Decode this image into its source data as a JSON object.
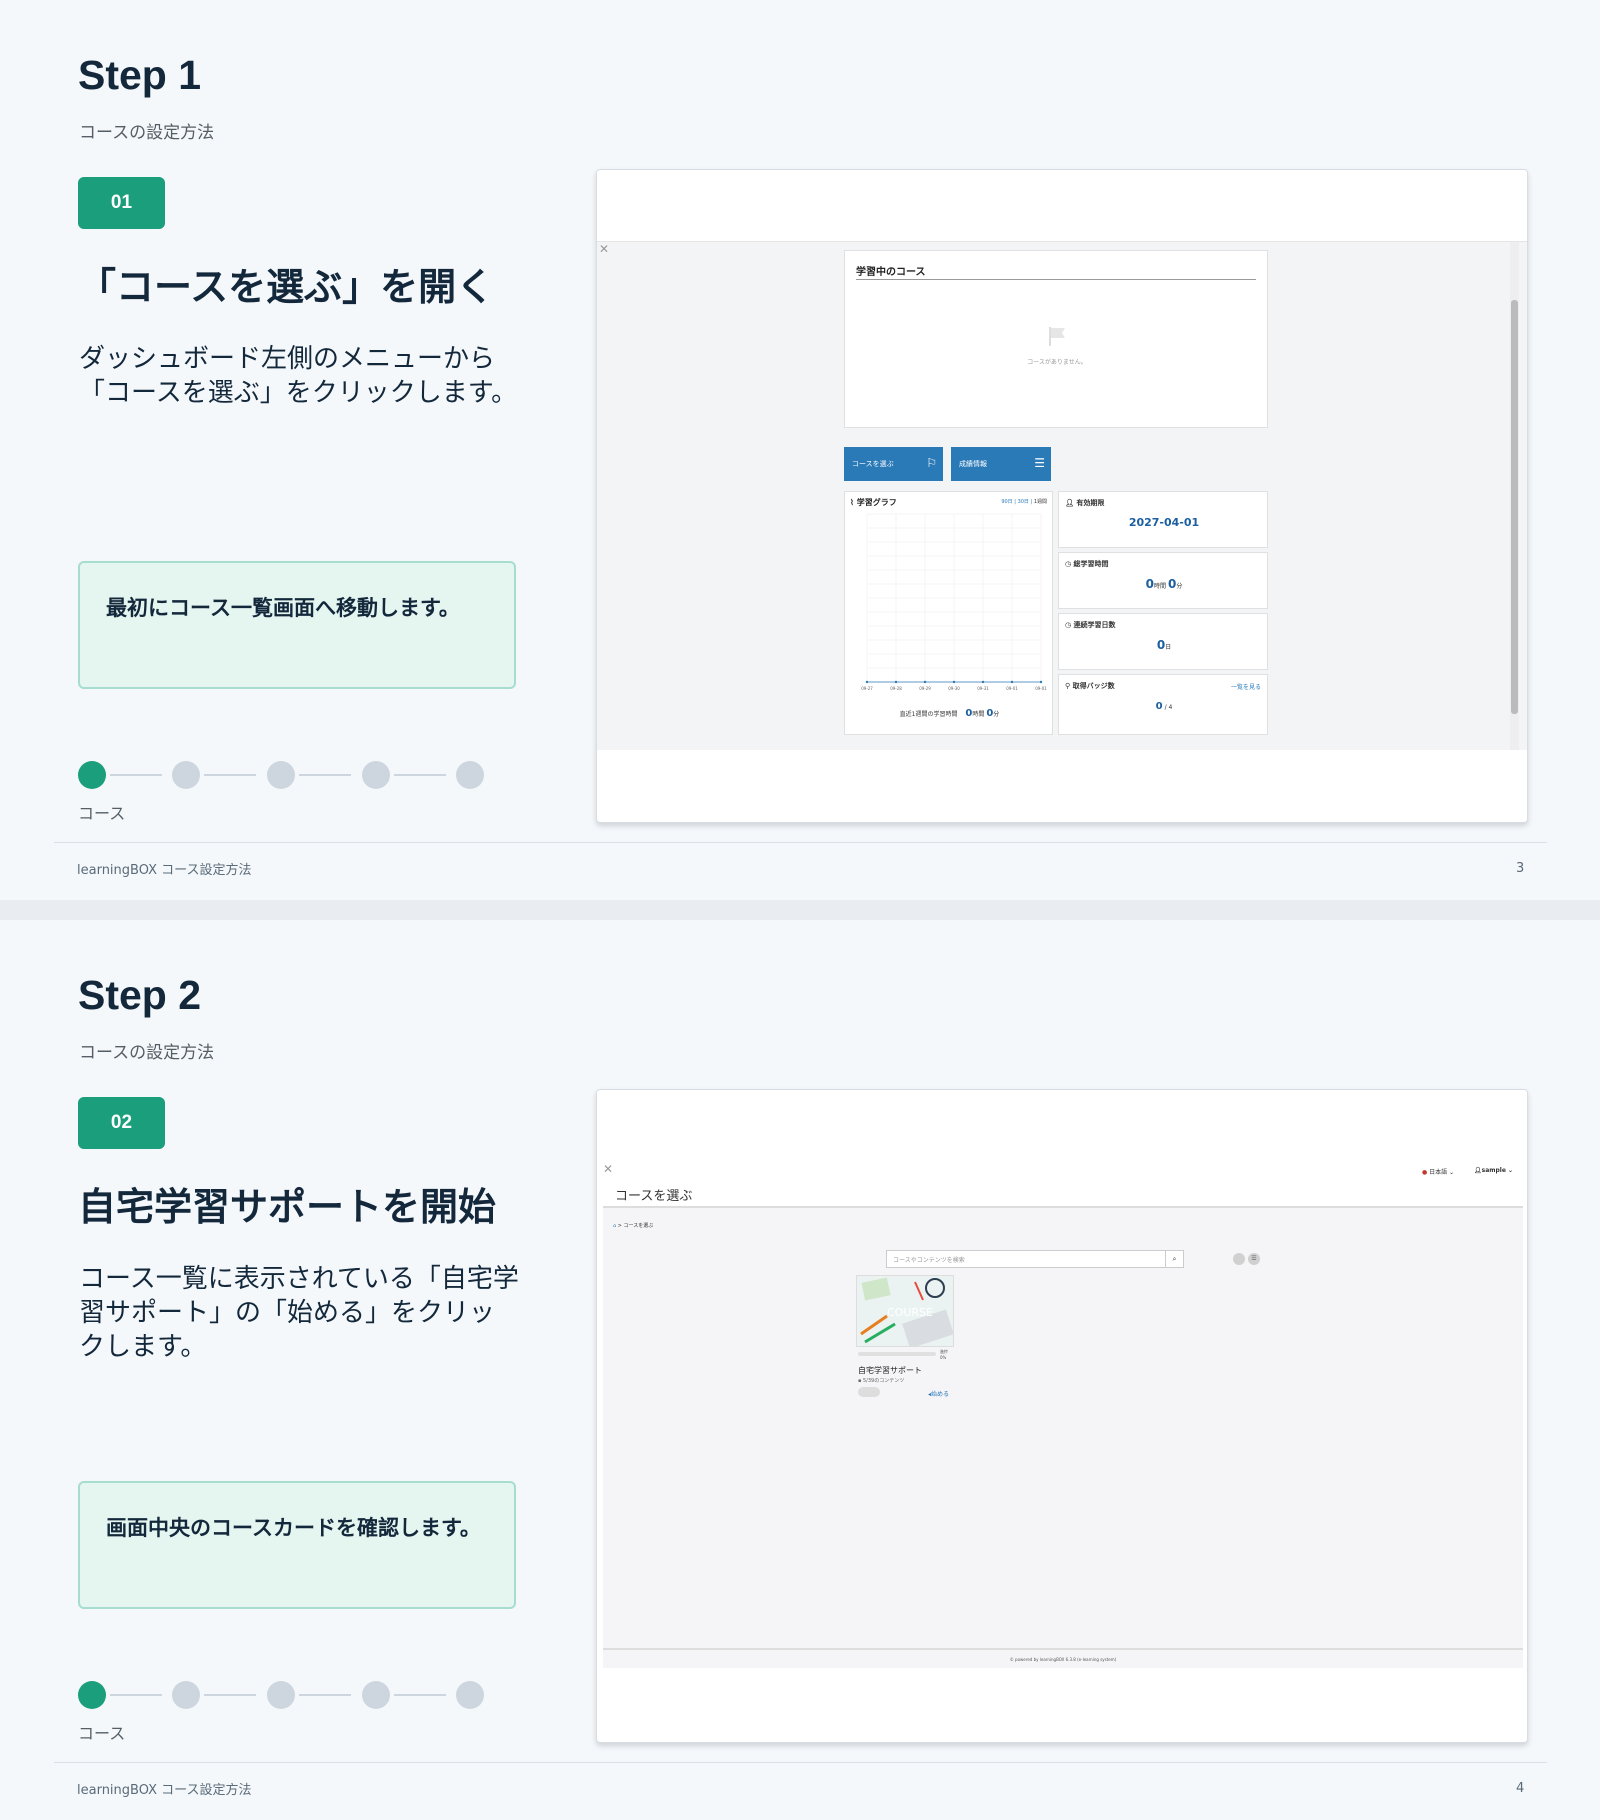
{
  "slides": [
    {
      "title": "Step 1",
      "subtitle": "コースの設定方法",
      "badge": "01",
      "heading": "「コースを選ぶ」を開く",
      "desc": "ダッシュボード左側のメニューから「コースを選ぶ」をクリックします。",
      "note": "最初にコース一覧画面へ移動します。",
      "step_label": "コース",
      "footer": "learningBOX コース設定方法",
      "page": "3",
      "screenshot": {
        "courses_title": "学習中のコース",
        "no_course": "コースがありません。",
        "btn_select": "コースを選ぶ",
        "btn_results": "成績情報",
        "graph_title": "学習グラフ",
        "graph_ranges": [
          "90日",
          "30日",
          "1週間"
        ],
        "graph_x": [
          "09-27",
          "09-28",
          "09-29",
          "09-30",
          "09-31",
          "09-01",
          "09-01"
        ],
        "graph_footer": "直近1週間の学習時間",
        "graph_total_h": "0",
        "graph_total_m": "0",
        "hour_unit": "時間",
        "min_unit": "分",
        "expiry_title": "有効期限",
        "expiry_value": "2027-04-01",
        "total_time_title": "総学習時間",
        "total_time_h": "0",
        "total_time_m": "0",
        "streak_title": "連続学習日数",
        "streak_value": "0",
        "streak_unit": "日",
        "badges_title": "取得バッジ数",
        "badges_link": "一覧を見る",
        "badges_value": "0",
        "badges_total": "/ 4"
      }
    },
    {
      "title": "Step 2",
      "subtitle": "コースの設定方法",
      "badge": "02",
      "heading": "自宅学習サポートを開始",
      "desc": "コース一覧に表示されている「自宅学習サポート」の「始める」をクリックします。",
      "note": "画面中央のコースカードを確認します。",
      "step_label": "コース",
      "footer": "learningBOX コース設定方法",
      "page": "4",
      "screenshot": {
        "lang": "日本語",
        "user": "sample",
        "page_title": "コースを選ぶ",
        "breadcrumb": "> コースを選ぶ",
        "search_placeholder": "コースやコンテンツを検索",
        "card_img_text": "COURSE",
        "card_progress": "進捗 0%",
        "card_title": "自宅学習サポート",
        "card_sub": "5/39のコンテンツ",
        "card_start": "始める",
        "powered": "© powered by learningBOX 6.3.8 (e-learning system)"
      }
    }
  ],
  "colors": {
    "accent": "#1a9e7c",
    "brand_blue": "#2a7ab8",
    "text": "#14283c"
  }
}
